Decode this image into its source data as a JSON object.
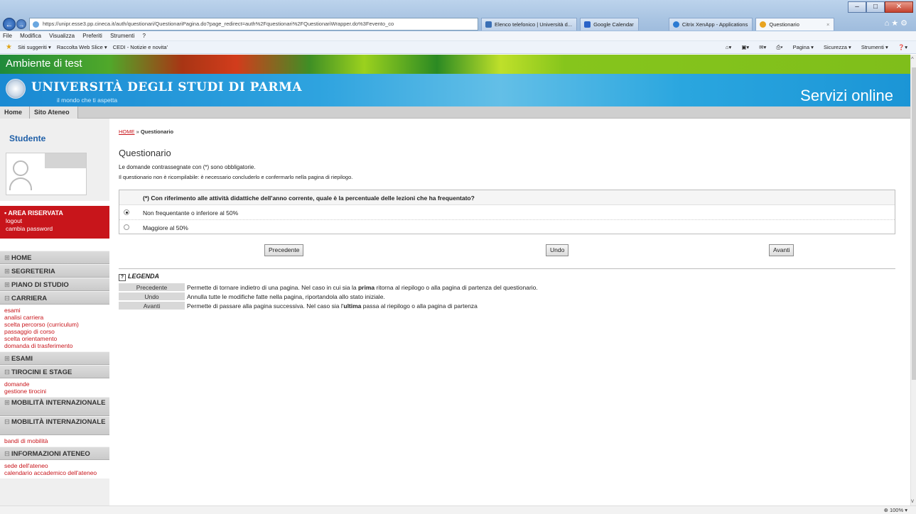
{
  "browser": {
    "address": "https://unipr.esse3.pp.cineca.it/auth/questionari/QuestionariPagina.do?page_redirect=auth%2Fquestionari%2FQuestionariWrapper.do%3Fevento_co",
    "tabs": [
      {
        "label": "Elenco telefonico | Università d...",
        "color": "#3a6fb5"
      },
      {
        "label": "Google Calendar",
        "color": "#2a63c8"
      },
      {
        "label": "Citrix XenApp - Applications",
        "color": "#2c7bd2"
      },
      {
        "label": "Questionario",
        "color": "#e8a320"
      }
    ],
    "menu": [
      "File",
      "Modifica",
      "Visualizza",
      "Preferiti",
      "Strumenti",
      "?"
    ],
    "favorites": [
      "Siti suggeriti ▾",
      "Raccolta Web Slice ▾",
      "CEDI - Notizie e novita'"
    ],
    "toolbar_right": [
      "Pagina ▾",
      "Sicurezza ▾",
      "Strumenti ▾"
    ],
    "zoom": "100%"
  },
  "banner": {
    "test_label": "Ambiente di test",
    "university": "UNIVERSITÀ DEGLI STUDI DI PARMA",
    "tagline": "il mondo che ti aspetta",
    "servizi": "Servizi online"
  },
  "topnav": {
    "home": "Home",
    "sito": "Sito Ateneo"
  },
  "sidebar": {
    "title": "Studente",
    "area_riservata": {
      "title": "AREA RISERVATA",
      "logout": "logout",
      "password": "cambia password"
    },
    "menu": [
      {
        "label": "HOME",
        "items": []
      },
      {
        "label": "SEGRETERIA",
        "items": []
      },
      {
        "label": "PIANO DI STUDIO",
        "items": []
      },
      {
        "label": "CARRIERA",
        "items": [
          "esami",
          "analisi carriera",
          "scelta percorso (curriculum)",
          "passaggio di corso",
          "scelta orientamento",
          "domanda di trasferimento"
        ]
      },
      {
        "label": "ESAMI",
        "items": []
      },
      {
        "label": "TIROCINI E STAGE",
        "items": [
          "domande",
          "gestione tirocini"
        ]
      },
      {
        "label": "MOBILITÀ INTERNAZIONALE",
        "items": []
      },
      {
        "label": "MOBILITÀ INTERNAZIONALE",
        "items": [
          "bandi di mobilità"
        ]
      },
      {
        "label": "INFORMAZIONI ATENEO",
        "items": [
          "sede dell'ateneo",
          "calendario accademico dell'ateneo"
        ]
      }
    ]
  },
  "main": {
    "breadcrumb_home": "HOME",
    "breadcrumb_sep": " » ",
    "breadcrumb_current": "Questionario",
    "title": "Questionario",
    "note1": "Le domande contrassegnate con (*) sono obbligatorie.",
    "note2": "Il questionario non è ricompilabile: è necessario concluderlo e confermarlo nella pagina di riepilogo.",
    "question": "(*) Con riferimento alle attività didattiche dell'anno corrente, quale è la percentuale delle lezioni che ha frequentato?",
    "options": [
      {
        "label": "Non frequentante o inferiore al 50%",
        "selected": true
      },
      {
        "label": "Maggiore al 50%",
        "selected": false
      }
    ],
    "buttons": {
      "prev": "Precedente",
      "undo": "Undo",
      "next": "Avanti"
    },
    "legend": {
      "title": "LEGENDA",
      "icon": "?",
      "rows": [
        {
          "button": "Precedente",
          "pre": "Permette di tornare indietro di una pagina. Nel caso in cui sia la ",
          "bold": "prima",
          "post": " ritorna al riepilogo o alla pagina di partenza del questionario."
        },
        {
          "button": "Undo",
          "pre": "Annulla tutte le modifiche fatte nella pagina, riportandola allo stato iniziale.",
          "bold": "",
          "post": ""
        },
        {
          "button": "Avanti",
          "pre": "Permette di passare alla pagina successiva. Nel caso sia l'",
          "bold": "ultima",
          "post": " passa al riepilogo o alla pagina di partenza"
        }
      ]
    }
  }
}
